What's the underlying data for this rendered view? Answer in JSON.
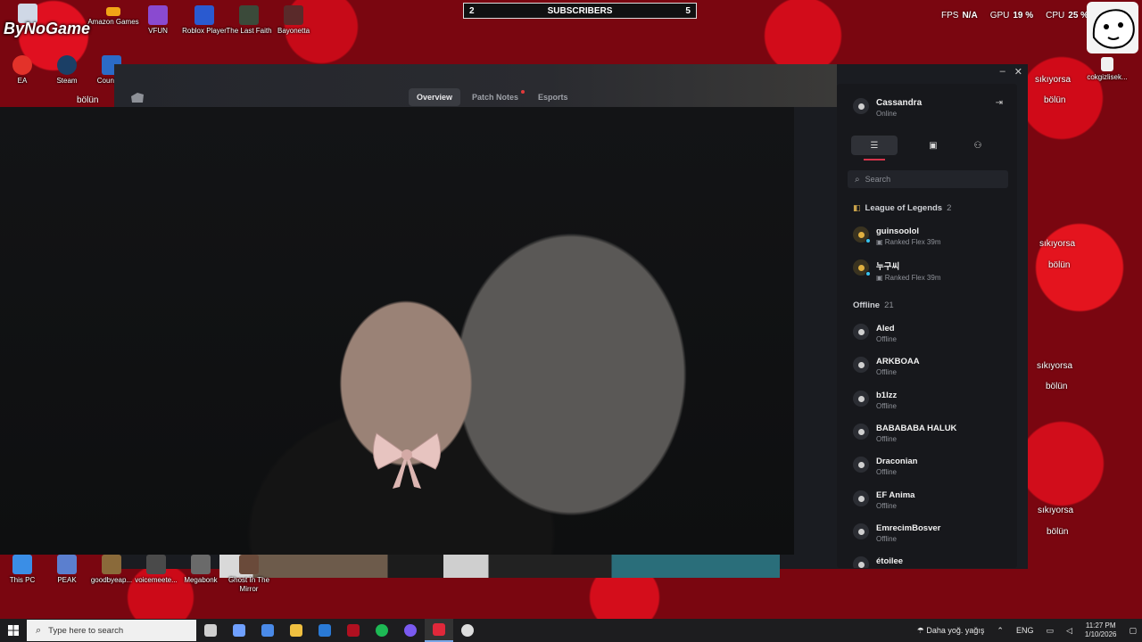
{
  "desktop": {
    "brand": "ByNoGame",
    "top_icons": [
      {
        "label": "Amazon Games",
        "sub": "games",
        "color": "#f2a516"
      },
      {
        "label": "VFUN",
        "color": "#8a4ad0"
      },
      {
        "label": "Roblox Player",
        "color": "#2a5ad0"
      },
      {
        "label": "The Last Faith",
        "color": "#3b4a3a"
      },
      {
        "label": "Bayonetta",
        "color": "#5a2a2a"
      }
    ],
    "second_row": [
      {
        "label": "EA",
        "color": "#e3322a"
      },
      {
        "label": "Steam",
        "color": "#1b3f66"
      },
      {
        "label": "Counte...",
        "color": "#2b6bc7"
      }
    ],
    "right_icons": [
      {
        "label": "cokgizlisek...",
        "color": "#f0f0f0"
      }
    ],
    "bottom_icons": [
      {
        "label": "This PC",
        "color": "#3a8ee6"
      },
      {
        "label": "PEAK",
        "color": "#5b7fcf"
      },
      {
        "label": "goodbyeap...",
        "color": "#8a6a3a"
      },
      {
        "label": "voicemeete...",
        "color": "#4a4a4a"
      },
      {
        "label": "Megabonk",
        "color": "#6a6a6a"
      },
      {
        "label": "Ghost In The Mirror",
        "color": "#6a4a3a"
      }
    ],
    "wallpaper_captions": [
      "sıkıyorsa",
      "bölün"
    ]
  },
  "overlay": {
    "subscribers_label": "SUBSCRIBERS",
    "subscribers_left": "2",
    "subscribers_right": "5",
    "fps_label": "FPS",
    "fps_value": "N/A",
    "gpu_label": "GPU",
    "gpu_value": "19 %",
    "cpu_label": "CPU",
    "cpu_value": "25 %"
  },
  "client": {
    "tabs": [
      {
        "label": "Overview",
        "active": true
      },
      {
        "label": "Patch Notes",
        "notify": true
      },
      {
        "label": "Esports"
      }
    ],
    "window_controls": [
      "–",
      "✕"
    ]
  },
  "friends_panel": {
    "me": {
      "name": "Cassandra",
      "status": "Online"
    },
    "search_placeholder": "Search",
    "groups": [
      {
        "title": "League of Legends",
        "count": "2",
        "friends": [
          {
            "name": "guinsoolol",
            "status": "Ranked Flex 39m"
          },
          {
            "name": "누구씨",
            "status": "Ranked Flex 39m"
          }
        ]
      },
      {
        "title": "Offline",
        "count": "21",
        "friends": [
          {
            "name": "Aled",
            "status": "Offline"
          },
          {
            "name": "ARKBOAA",
            "status": "Offline"
          },
          {
            "name": "b1lzz",
            "status": "Offline"
          },
          {
            "name": "BABABABA HALUK",
            "status": "Offline"
          },
          {
            "name": "Draconian",
            "status": "Offline"
          },
          {
            "name": "EF Anima",
            "status": "Offline"
          },
          {
            "name": "EmrecimBosver",
            "status": "Offline"
          },
          {
            "name": "étoilee",
            "status": ""
          }
        ]
      }
    ]
  },
  "taskbar": {
    "search_placeholder": "Type here to search",
    "apps": [
      {
        "name": "task-view",
        "color": "#cfcfcf"
      },
      {
        "name": "copilot",
        "color": "#6fa0ff"
      },
      {
        "name": "store",
        "color": "#4a8ae8"
      },
      {
        "name": "file-explorer",
        "color": "#f0c040"
      },
      {
        "name": "outlook",
        "color": "#2a7ad6"
      },
      {
        "name": "app-red",
        "color": "#b01020"
      },
      {
        "name": "spotify",
        "color": "#1db954"
      },
      {
        "name": "discord",
        "color": "#7a5af0"
      },
      {
        "name": "riot-client",
        "color": "#e0283a",
        "active": true
      },
      {
        "name": "obs",
        "color": "#dddddd"
      }
    ],
    "weather": "Daha yoğ. yağış",
    "language": "ENG",
    "time": "11:27 PM",
    "date": "1/10/2026"
  }
}
